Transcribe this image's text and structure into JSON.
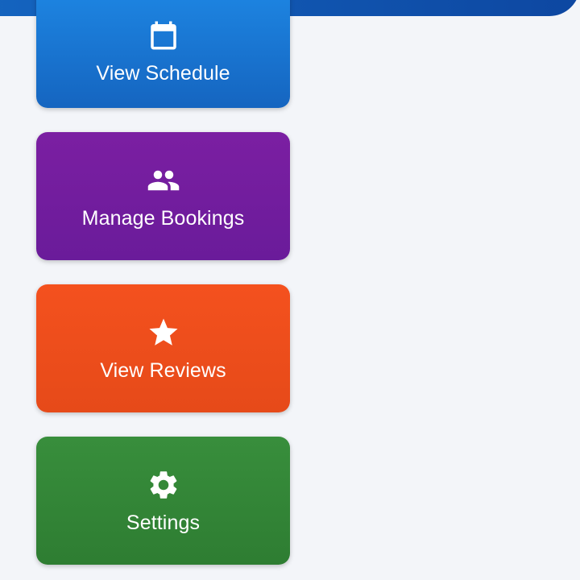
{
  "colors": {
    "background": "#f3f5f9",
    "banner": "#0d47a1",
    "schedule": "#1e88e5",
    "bookings": "#7b1fa2",
    "reviews": "#f4511e",
    "settings": "#388e3c"
  },
  "menu": {
    "items": [
      {
        "label": "View Schedule",
        "icon": "calendar-icon"
      },
      {
        "label": "Manage Bookings",
        "icon": "people-icon"
      },
      {
        "label": "View Reviews",
        "icon": "star-icon"
      },
      {
        "label": "Settings",
        "icon": "gear-icon"
      }
    ]
  }
}
